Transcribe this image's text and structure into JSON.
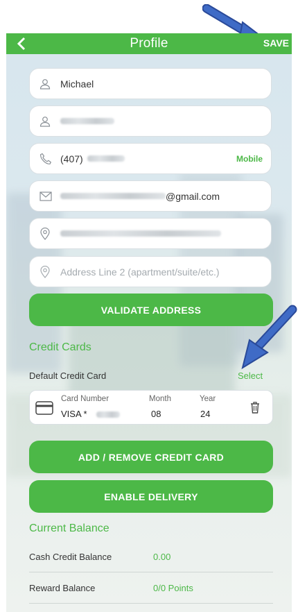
{
  "header": {
    "title": "Profile",
    "save_label": "SAVE"
  },
  "form": {
    "first_name": "Michael",
    "phone_prefix": "(407)",
    "phone_type": "Mobile",
    "email_suffix": "@gmail.com",
    "address2_placeholder": "Address Line 2 (apartment/suite/etc.)",
    "validate_label": "VALIDATE ADDRESS"
  },
  "credit_cards": {
    "section_title": "Credit Cards",
    "default_label": "Default Credit Card",
    "select_label": "Select",
    "card": {
      "number_label": "Card Number",
      "number_value": "VISA *",
      "month_label": "Month",
      "month_value": "08",
      "year_label": "Year",
      "year_value": "24"
    },
    "add_remove_label": "ADD / REMOVE CREDIT CARD"
  },
  "delivery": {
    "enable_label": "ENABLE DELIVERY"
  },
  "balance": {
    "section_title": "Current Balance",
    "rows": [
      {
        "label": "Cash Credit Balance",
        "value": "0.00"
      },
      {
        "label": "Reward Balance",
        "value": "0/0 Points"
      }
    ]
  },
  "colors": {
    "accent": "#4cb847",
    "arrow": "#3f6bc6"
  }
}
